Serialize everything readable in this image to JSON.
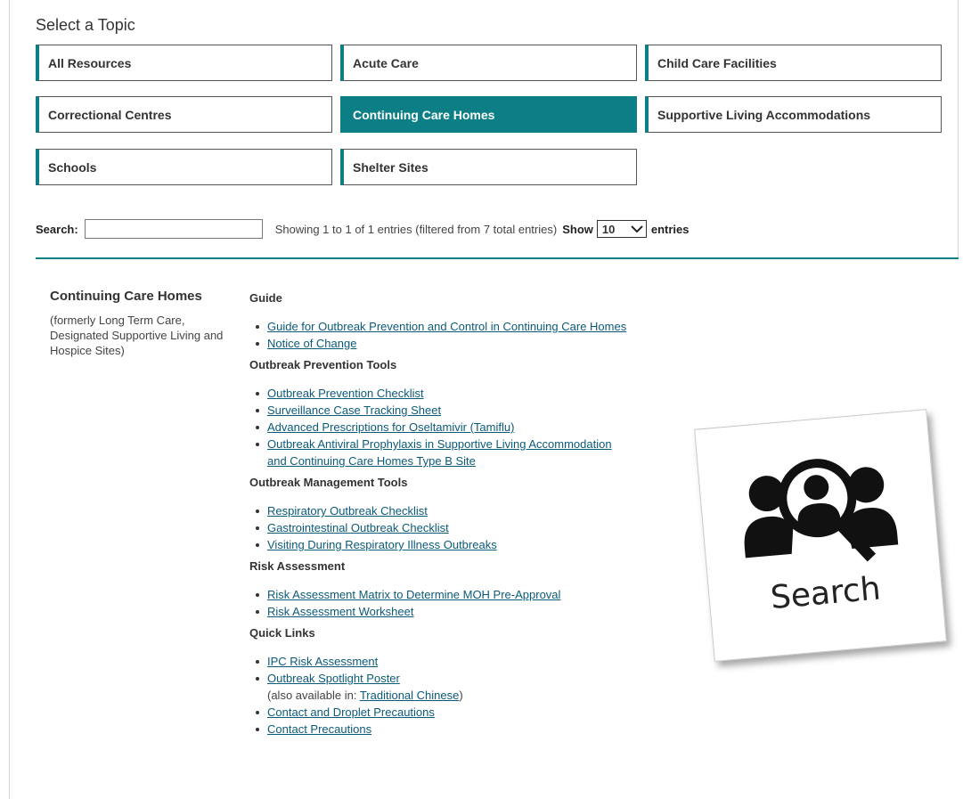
{
  "topics": {
    "heading": "Select a Topic",
    "buttons": [
      {
        "label": "All Resources"
      },
      {
        "label": "Acute Care"
      },
      {
        "label": "Child Care Facilities"
      },
      {
        "label": "Correctional Centres"
      },
      {
        "label": "Continuing Care Homes",
        "active": true
      },
      {
        "label": "Supportive Living Accommodations"
      },
      {
        "label": "Schools"
      },
      {
        "label": "Shelter Sites"
      }
    ]
  },
  "search": {
    "label": "Search:",
    "value": "",
    "info": "Showing 1 to 1 of 1 entries (filtered from 7 total entries)",
    "show_label": "Show",
    "page_size": "10",
    "entries_label": "entries"
  },
  "entry": {
    "title": "Continuing Care Homes",
    "note": "(formerly Long Term Care, Designated Supportive Living and Hospice Sites)",
    "sections": [
      {
        "title": "Guide",
        "links": [
          "Guide for Outbreak Prevention and Control in Continuing Care Homes",
          "Notice of Change"
        ]
      },
      {
        "title": "Outbreak Prevention Tools",
        "links": [
          "Outbreak Prevention Checklist",
          "Surveillance Case Tracking Sheet",
          "Advanced Prescriptions for Oseltamivir (Tamiflu)",
          "Outbreak Antiviral Prophylaxis in Supportive Living Accommodation and Continuing Care Homes Type B Site"
        ]
      },
      {
        "title": "Outbreak Management Tools",
        "links": [
          "Respiratory Outbreak Checklist",
          "Gastrointestinal Outbreak Checklist",
          "Visiting During Respiratory Illness Outbreaks"
        ]
      },
      {
        "title": "Risk Assessment",
        "links": [
          "Risk Assessment Matrix to Determine MOH Pre-Approval",
          "Risk Assessment Worksheet"
        ]
      },
      {
        "title": "Quick Links",
        "links": [
          "IPC Risk Assessment",
          "Outbreak Spotlight Poster",
          "Contact and Droplet Precautions",
          "Contact Precautions"
        ]
      }
    ],
    "poster_note_prefix": "(also available in: ",
    "poster_note_link": "Traditional Chinese",
    "poster_note_suffix": ")"
  },
  "overlay": {
    "icon": "people-search-icon",
    "label": "Search"
  },
  "colors": {
    "accent": "#0c7f86",
    "link": "#0b5a7a"
  }
}
